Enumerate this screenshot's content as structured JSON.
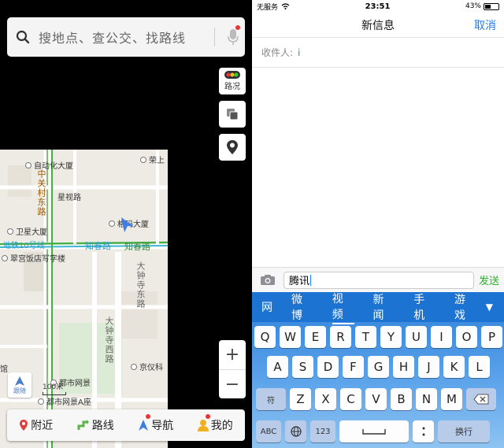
{
  "map_app": {
    "search": {
      "placeholder": "搜地点、查公交、找路线"
    },
    "tools": {
      "traffic_label": "路况"
    },
    "pois": {
      "p1": "自动化大厦",
      "p2": "荣上",
      "p3": "星视路",
      "p4": "格玛大厦",
      "p5": "卫星大厦",
      "p6": "地铁10号线",
      "p7": "知春路",
      "p8": "知春路",
      "p9": "翠宫饭店写字楼",
      "p10": "京仪科",
      "p11": "都市网景",
      "p12": "都市网景A座",
      "p13": "馆"
    },
    "streets": {
      "s1": "中关村东路",
      "s2": "大钟寺东路",
      "s3": "大钟寺西路"
    },
    "controls": {
      "zoom_in": "+",
      "zoom_out": "−",
      "follow_label": "跟随",
      "scale_label": "100米"
    },
    "bottom_tabs": {
      "nearby": "附近",
      "route": "路线",
      "navigate": "导航",
      "mine": "我的"
    }
  },
  "messages_app": {
    "status": {
      "carrier": "无服务",
      "time": "23:51",
      "battery": "43%"
    },
    "nav": {
      "title": "新信息",
      "cancel": "取消"
    },
    "recipient_label": "收件人:",
    "recipient_caret": "i",
    "compose": {
      "text": "腾讯",
      "send": "发送"
    },
    "candidates": [
      "网",
      "微博",
      "视频",
      "新闻",
      "手机",
      "游戏"
    ],
    "keyboard": {
      "row1": [
        "Q",
        "W",
        "E",
        "R",
        "T",
        "Y",
        "U",
        "I",
        "O",
        "P"
      ],
      "row2": [
        "A",
        "S",
        "D",
        "F",
        "G",
        "H",
        "J",
        "K",
        "L"
      ],
      "row3": [
        "Z",
        "X",
        "C",
        "V",
        "B",
        "N",
        "M"
      ],
      "shift": "符",
      "abc": "ABC",
      "num": "123",
      "return": "换行"
    }
  },
  "colors": {
    "map_bg": "#eeebe4",
    "road_green": "#46b046",
    "metro": "#3fb5d6",
    "ios_blue": "#1a7ef5",
    "send_green": "#2bb02b",
    "keyboard_blue": "#2d7fd8"
  }
}
